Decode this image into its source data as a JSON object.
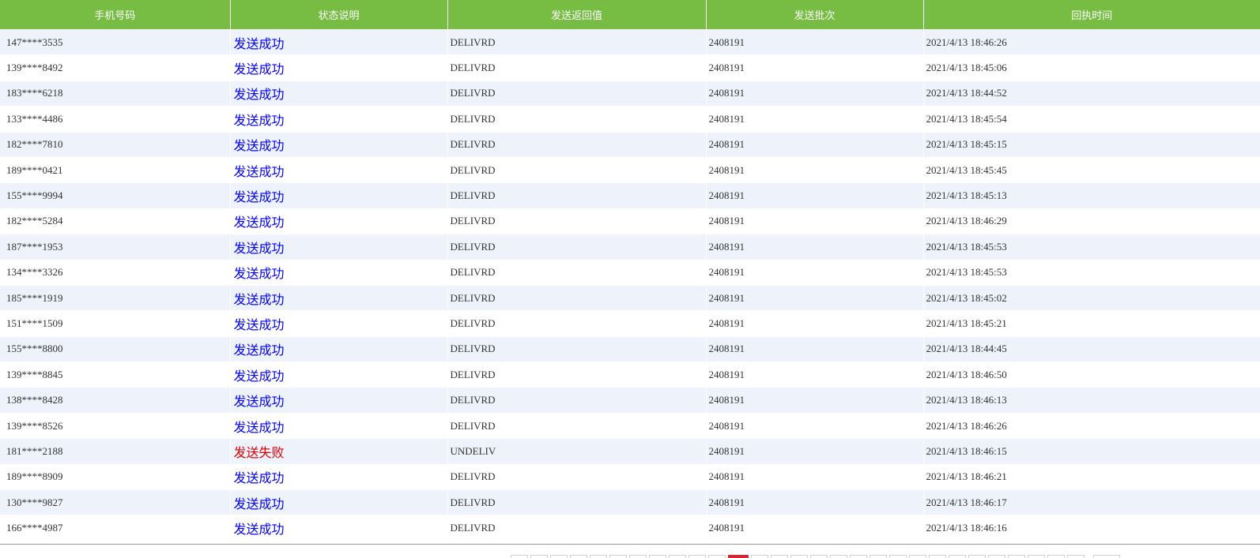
{
  "table": {
    "headers": [
      "手机号码",
      "状态说明",
      "发送返回值",
      "发送批次",
      "回执时间"
    ],
    "rows": [
      {
        "phone": "147****3535",
        "status": "发送成功",
        "status_type": "success",
        "code": "DELIVRD",
        "batch": "2408191",
        "time": "2021/4/13 18:46:26"
      },
      {
        "phone": "139****8492",
        "status": "发送成功",
        "status_type": "success",
        "code": "DELIVRD",
        "batch": "2408191",
        "time": "2021/4/13 18:45:06"
      },
      {
        "phone": "183****6218",
        "status": "发送成功",
        "status_type": "success",
        "code": "DELIVRD",
        "batch": "2408191",
        "time": "2021/4/13 18:44:52"
      },
      {
        "phone": "133****4486",
        "status": "发送成功",
        "status_type": "success",
        "code": "DELIVRD",
        "batch": "2408191",
        "time": "2021/4/13 18:45:54"
      },
      {
        "phone": "182****7810",
        "status": "发送成功",
        "status_type": "success",
        "code": "DELIVRD",
        "batch": "2408191",
        "time": "2021/4/13 18:45:15"
      },
      {
        "phone": "189****0421",
        "status": "发送成功",
        "status_type": "success",
        "code": "DELIVRD",
        "batch": "2408191",
        "time": "2021/4/13 18:45:45"
      },
      {
        "phone": "155****9994",
        "status": "发送成功",
        "status_type": "success",
        "code": "DELIVRD",
        "batch": "2408191",
        "time": "2021/4/13 18:45:13"
      },
      {
        "phone": "182****5284",
        "status": "发送成功",
        "status_type": "success",
        "code": "DELIVRD",
        "batch": "2408191",
        "time": "2021/4/13 18:46:29"
      },
      {
        "phone": "187****1953",
        "status": "发送成功",
        "status_type": "success",
        "code": "DELIVRD",
        "batch": "2408191",
        "time": "2021/4/13 18:45:53"
      },
      {
        "phone": "134****3326",
        "status": "发送成功",
        "status_type": "success",
        "code": "DELIVRD",
        "batch": "2408191",
        "time": "2021/4/13 18:45:53"
      },
      {
        "phone": "185****1919",
        "status": "发送成功",
        "status_type": "success",
        "code": "DELIVRD",
        "batch": "2408191",
        "time": "2021/4/13 18:45:02"
      },
      {
        "phone": "151****1509",
        "status": "发送成功",
        "status_type": "success",
        "code": "DELIVRD",
        "batch": "2408191",
        "time": "2021/4/13 18:45:21"
      },
      {
        "phone": "155****8800",
        "status": "发送成功",
        "status_type": "success",
        "code": "DELIVRD",
        "batch": "2408191",
        "time": "2021/4/13 18:44:45"
      },
      {
        "phone": "139****8845",
        "status": "发送成功",
        "status_type": "success",
        "code": "DELIVRD",
        "batch": "2408191",
        "time": "2021/4/13 18:46:50"
      },
      {
        "phone": "138****8428",
        "status": "发送成功",
        "status_type": "success",
        "code": "DELIVRD",
        "batch": "2408191",
        "time": "2021/4/13 18:46:13"
      },
      {
        "phone": "139****8526",
        "status": "发送成功",
        "status_type": "success",
        "code": "DELIVRD",
        "batch": "2408191",
        "time": "2021/4/13 18:46:26"
      },
      {
        "phone": "181****2188",
        "status": "发送失败",
        "status_type": "fail",
        "code": "UNDELIV",
        "batch": "2408191",
        "time": "2021/4/13 18:46:15"
      },
      {
        "phone": "189****8909",
        "status": "发送成功",
        "status_type": "success",
        "code": "DELIVRD",
        "batch": "2408191",
        "time": "2021/4/13 18:46:21"
      },
      {
        "phone": "130****9827",
        "status": "发送成功",
        "status_type": "success",
        "code": "DELIVRD",
        "batch": "2408191",
        "time": "2021/4/13 18:46:17"
      },
      {
        "phone": "166****4987",
        "status": "发送成功",
        "status_type": "success",
        "code": "DELIVRD",
        "batch": "2408191",
        "time": "2021/4/13 18:46:16"
      }
    ]
  },
  "pager": {
    "page_count": 29,
    "active_index": 11
  },
  "colors": {
    "header_bg": "#77bd44",
    "row_alt_bg": "#eef2fb",
    "success_text": "#0000ee",
    "fail_text": "#dd0000",
    "pager_active": "#d9232e"
  }
}
